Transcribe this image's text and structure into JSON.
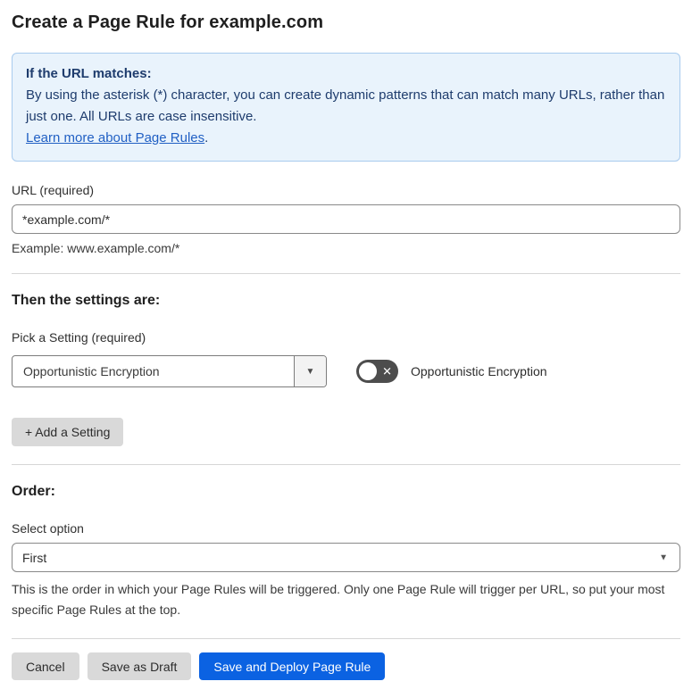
{
  "page": {
    "title": "Create a Page Rule for example.com"
  },
  "info_box": {
    "heading": "If the URL matches:",
    "body": "By using the asterisk (*) character, you can create dynamic patterns that can match many URLs, rather than just one. All URLs are case insensitive.",
    "link_label": "Learn more about Page Rules",
    "link_suffix": "."
  },
  "url_section": {
    "label": "URL (required)",
    "input_value": "*example.com/*",
    "helper": "Example: www.example.com/*"
  },
  "settings_section": {
    "heading": "Then the settings are:",
    "picker_label": "Pick a Setting (required)",
    "selected_setting": "Opportunistic Encryption",
    "toggle_state": "off",
    "toggle_label": "Opportunistic Encryption",
    "add_button_label": "+ Add a Setting"
  },
  "order_section": {
    "heading": "Order:",
    "label": "Select option",
    "selected_option": "First",
    "description": "This is the order in which your Page Rules will be triggered. Only one Page Rule will trigger per URL, so put your most specific Page Rules at the top."
  },
  "footer": {
    "cancel_label": "Cancel",
    "save_draft_label": "Save as Draft",
    "save_deploy_label": "Save and Deploy Page Rule"
  },
  "icons": {
    "chevron_down": "▼",
    "toggle_off_x": "✕"
  },
  "colors": {
    "primary_blue": "#0b62e2",
    "info_bg": "#e9f3fc",
    "info_border": "#a9cbee",
    "info_text": "#1e3c6d",
    "link_blue": "#2160c4",
    "toggle_off_bg": "#4d4d4d",
    "button_gray": "#d9d9d9"
  }
}
